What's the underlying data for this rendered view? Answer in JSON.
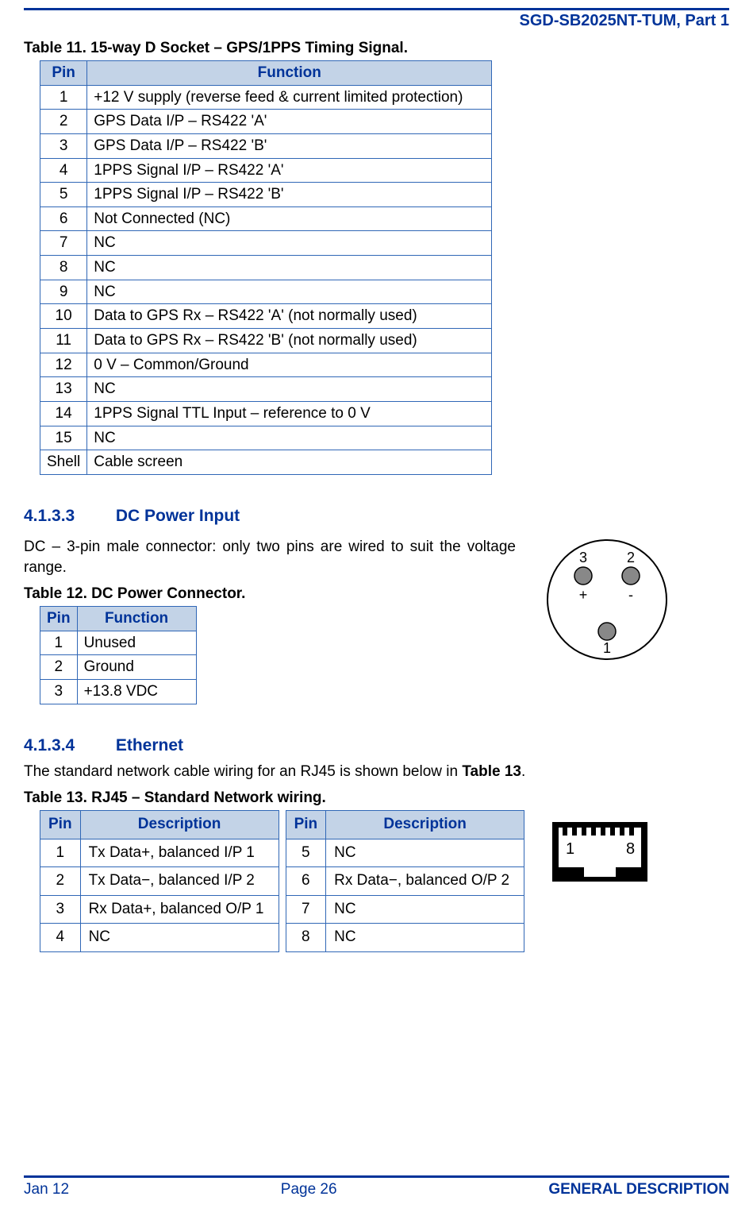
{
  "header": {
    "doc_title": "SGD-SB2025NT-TUM, Part 1"
  },
  "table11": {
    "caption": "Table 11.  15-way D Socket – GPS/1PPS Timing Signal.",
    "col_pin": "Pin",
    "col_func": "Function",
    "rows": [
      {
        "pin": "1",
        "func": "+12 V supply (reverse feed & current limited protection)"
      },
      {
        "pin": "2",
        "func": "GPS Data I/P – RS422 'A'"
      },
      {
        "pin": "3",
        "func": "GPS Data I/P – RS422 'B'"
      },
      {
        "pin": "4",
        "func": "1PPS Signal I/P – RS422 'A'"
      },
      {
        "pin": "5",
        "func": "1PPS Signal I/P – RS422 'B'"
      },
      {
        "pin": "6",
        "func": "Not Connected (NC)"
      },
      {
        "pin": "7",
        "func": "NC"
      },
      {
        "pin": "8",
        "func": "NC"
      },
      {
        "pin": "9",
        "func": "NC"
      },
      {
        "pin": "10",
        "func": "Data to GPS Rx – RS422 'A' (not normally used)"
      },
      {
        "pin": "11",
        "func": "Data to GPS Rx – RS422 'B' (not normally used)"
      },
      {
        "pin": "12",
        "func": "0 V – Common/Ground"
      },
      {
        "pin": "13",
        "func": "NC"
      },
      {
        "pin": "14",
        "func": "1PPS Signal TTL Input – reference to 0 V"
      },
      {
        "pin": "15",
        "func": "NC"
      },
      {
        "pin": "Shell",
        "func": "Cable screen"
      }
    ]
  },
  "sec_dc": {
    "num": "4.1.3.3",
    "title": "DC Power Input",
    "para": "DC – 3-pin male connector: only two pins are wired to suit the voltage range."
  },
  "table12": {
    "caption": "Table 12.  DC Power Connector.",
    "col_pin": "Pin",
    "col_func": "Function",
    "rows": [
      {
        "pin": "1",
        "func": "Unused"
      },
      {
        "pin": "2",
        "func": "Ground"
      },
      {
        "pin": "3",
        "func": "+13.8 VDC"
      }
    ]
  },
  "connector_diagram": {
    "pin3": "3",
    "pin2": "2",
    "pin1": "1",
    "plus": "+",
    "minus": "-"
  },
  "sec_eth": {
    "num": "4.1.3.4",
    "title": "Ethernet",
    "para_pre": "The standard network cable wiring for an RJ45 is shown below in ",
    "para_ref": "Table 13",
    "para_post": "."
  },
  "table13": {
    "caption": "Table 13.  RJ45 – Standard Network wiring.",
    "col_pin": "Pin",
    "col_desc": "Description",
    "left": [
      {
        "pin": "1",
        "desc": "Tx Data+, balanced I/P 1"
      },
      {
        "pin": "2",
        "desc": "Tx Data−, balanced I/P 2"
      },
      {
        "pin": "3",
        "desc": "Rx Data+, balanced O/P 1"
      },
      {
        "pin": "4",
        "desc": "NC"
      }
    ],
    "right": [
      {
        "pin": "5",
        "desc": "NC"
      },
      {
        "pin": "6",
        "desc": "Rx Data−, balanced O/P 2"
      },
      {
        "pin": "7",
        "desc": "NC"
      },
      {
        "pin": "8",
        "desc": "NC"
      }
    ]
  },
  "rj45_diagram": {
    "left_label": "1",
    "right_label": "8"
  },
  "footer": {
    "date": "Jan 12",
    "page": "Page 26",
    "section": "GENERAL DESCRIPTION"
  }
}
